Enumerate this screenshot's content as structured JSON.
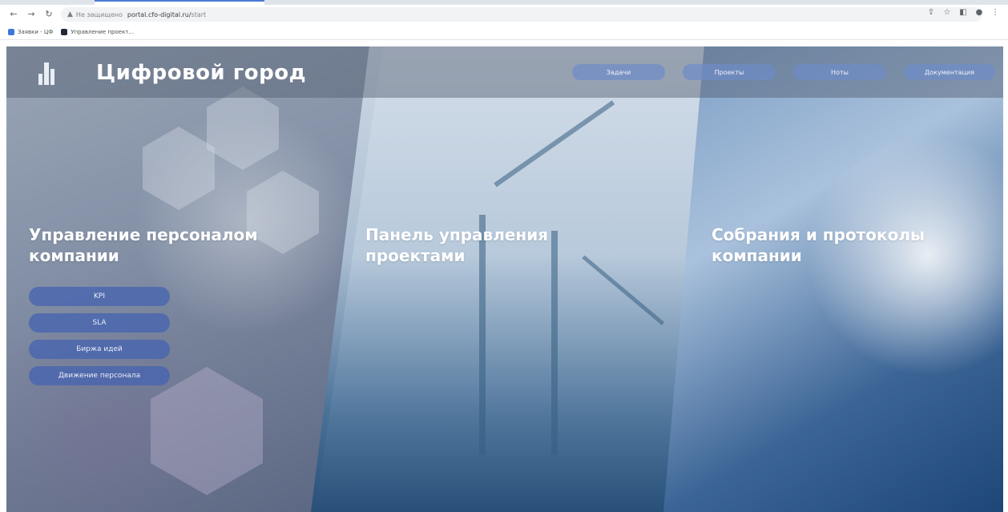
{
  "browser": {
    "address_secure_label": "Не защищено",
    "address_host": "portal.cfo-digital.ru/",
    "address_path": "start",
    "bookmarks": [
      {
        "label": "Заявки - ЦФ",
        "color": "#3b78d8"
      },
      {
        "label": "Управление проект...",
        "color": "#1f2937"
      }
    ]
  },
  "site": {
    "title": "Цифровой город",
    "nav": [
      {
        "label": "Задачи"
      },
      {
        "label": "Проекты"
      },
      {
        "label": "Ноты"
      },
      {
        "label": "Документация"
      }
    ]
  },
  "sections": {
    "hr": {
      "line1": "Управление персоналом",
      "line2": "компании"
    },
    "projects": {
      "line1": "Панель управления",
      "line2": "проектами"
    },
    "meetings": {
      "line1": "Собрания и протоколы",
      "line2": "компании"
    }
  },
  "hr_buttons": [
    {
      "label": "KPI"
    },
    {
      "label": "SLA"
    },
    {
      "label": "Биржа идей"
    },
    {
      "label": "Движение персонала"
    }
  ],
  "colors": {
    "accent": "#4a7bd6",
    "button": "#4664af"
  }
}
